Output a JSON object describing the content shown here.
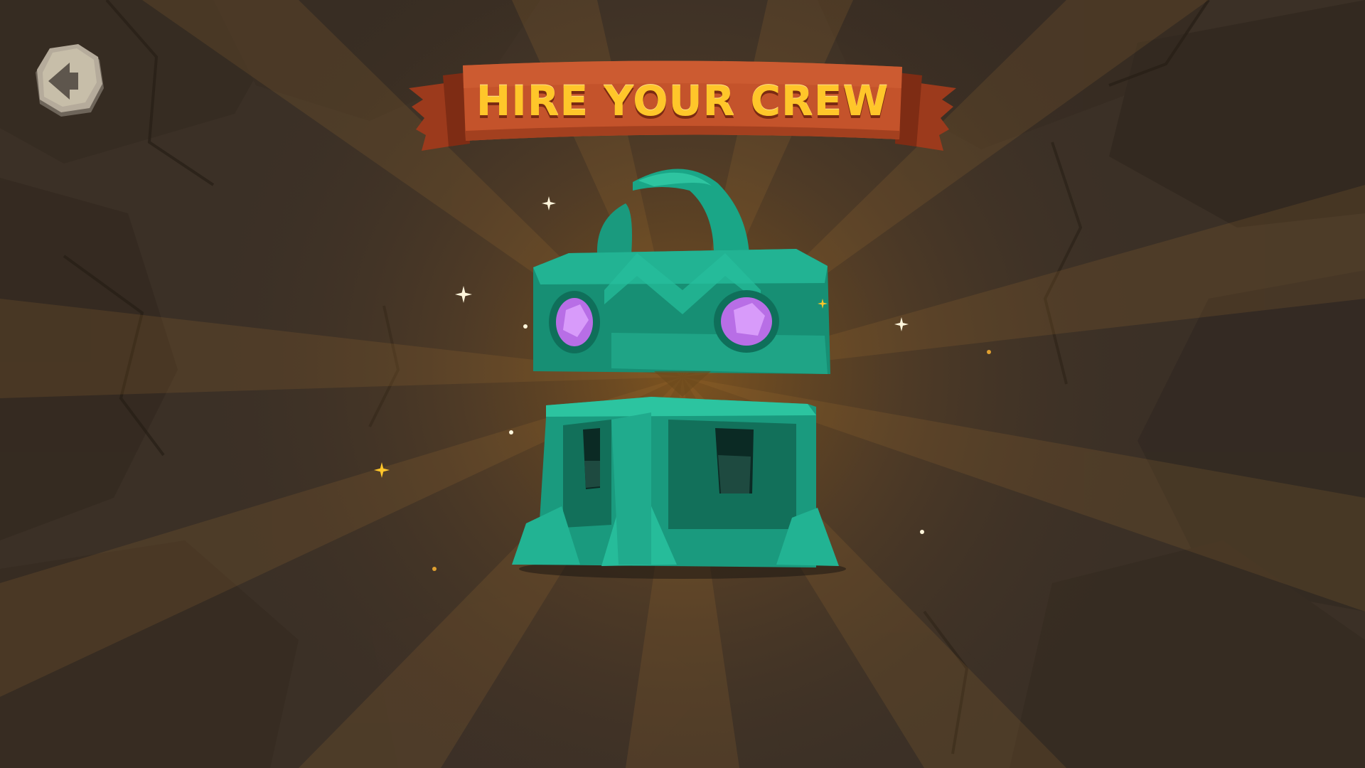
{
  "screen": {
    "title": "HIRE YOUR CREW"
  },
  "buttons": {
    "back": {
      "icon": "arrow-left-icon"
    }
  },
  "chest": {
    "icon": "jade-chest-icon",
    "gem_color": "#b86ee6"
  },
  "colors": {
    "background": "#3a2f24",
    "banner": "#c0502a",
    "title": "#ffc62a",
    "chest": "#1fae8e"
  }
}
